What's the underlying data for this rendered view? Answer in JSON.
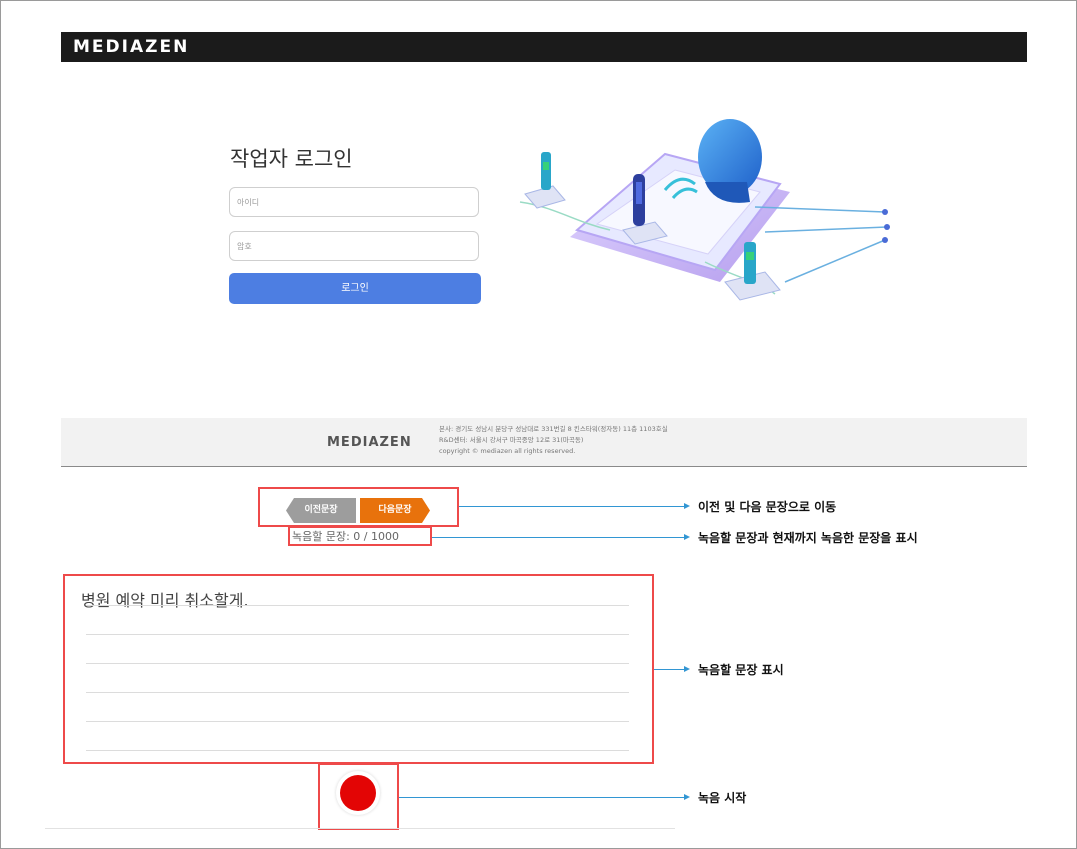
{
  "header": {
    "logo_text": "MEDIAZEN"
  },
  "login": {
    "title": "작업자 로그인",
    "id_placeholder": "아이디",
    "password_placeholder": "암호",
    "login_button": "로그인"
  },
  "footer": {
    "logo_text": "MEDIAZEN",
    "address_line1": "본사: 경기도 성남시 분당구 성남대로 331번길 8 킨스타워(정자동) 11층 1103호실",
    "address_line2": "R&D센터: 서울시 강서구 마곡중앙 12로 31(마곡동)",
    "copyright": "copyright © mediazen all rights reserved."
  },
  "recorder": {
    "prev_button": "이전문장",
    "next_button": "다음문장",
    "progress_text": "녹음할 문장: 0 / 1000",
    "sentence": "병원 예약 미리 취소할게."
  },
  "annotations": {
    "nav": "이전 및 다음 문장으로 이동",
    "progress": "녹음할 문장과 현재까지 녹음한 문장을 표시",
    "sentence": "녹음할 문장 표시",
    "record": "녹음 시작"
  },
  "colors": {
    "login_button": "#4d7ee2",
    "next_button": "#e8720c",
    "prev_button": "#9d9d9d",
    "record_button": "#e30505",
    "highlight_box": "#ee4a4a",
    "callout_arrow": "#3296d3"
  }
}
